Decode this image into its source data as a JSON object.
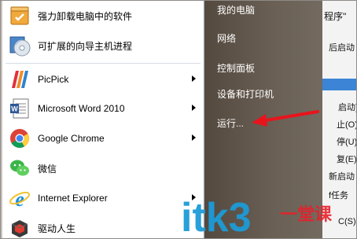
{
  "programs": [
    {
      "label": "强力卸载电脑中的软件",
      "icon": "uninstall-icon",
      "has_arrow": false
    },
    {
      "label": "可扩展的向导主机进程",
      "icon": "wizard-disc-icon",
      "has_arrow": false
    },
    {
      "label": "PicPick",
      "icon": "picpick-icon",
      "has_arrow": true
    },
    {
      "label": "Microsoft Word 2010",
      "icon": "word-icon",
      "has_arrow": true
    },
    {
      "label": "Google Chrome",
      "icon": "chrome-icon",
      "has_arrow": true
    },
    {
      "label": "微信",
      "icon": "wechat-icon",
      "has_arrow": false
    },
    {
      "label": "Internet Explorer",
      "icon": "ie-icon",
      "has_arrow": true
    },
    {
      "label": "驱动人生",
      "icon": "driver-life-icon",
      "has_arrow": false
    }
  ],
  "right_links": [
    {
      "label": "我的电脑"
    },
    {
      "label": "网络"
    },
    {
      "label": "控制面板"
    },
    {
      "label": "设备和打印机"
    },
    {
      "label": "运行..."
    }
  ],
  "background_window": {
    "lines": [
      "程序\"",
      "后启动",
      "",
      "",
      "启动)",
      "止(O)",
      "停(U)",
      "复(E)",
      "新启动",
      "f任务",
      "C(S)"
    ]
  },
  "annotation": {
    "arrow_color": "#e8141c",
    "target": "运行..."
  },
  "watermark": {
    "text": "itk3",
    "accent": "一堂课",
    "color": "#1d9bd7",
    "accent_color": "#e8202a"
  },
  "colors": {
    "left_pane": "#ffffff",
    "right_pane": "#5f554b",
    "link_text": "#ffffff"
  }
}
